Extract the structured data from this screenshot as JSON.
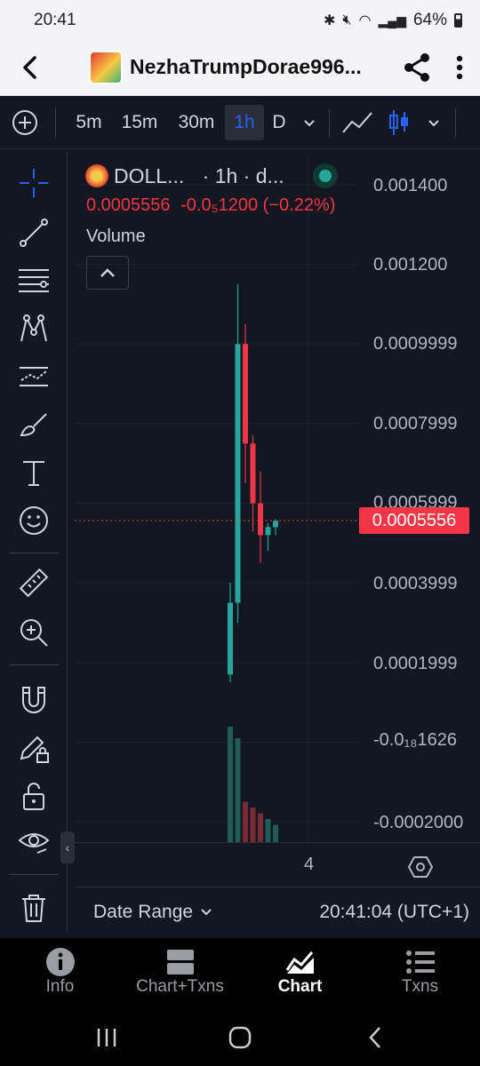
{
  "status_bar": {
    "time": "20:41",
    "battery": "64%"
  },
  "header": {
    "title": "NezhaTrumpDorae996..."
  },
  "toolbar": {
    "intervals": [
      "5m",
      "15m",
      "30m",
      "1h",
      "D"
    ],
    "active_interval": "1h"
  },
  "legend": {
    "symbol": "DOLL...",
    "interval_info": "· 1h · d...",
    "price": "0.0005556",
    "change": "-0.0₅1200 (−0.22%)",
    "volume_label": "Volume"
  },
  "price_axis": {
    "labels": [
      "0.001400",
      "0.001200",
      "0.0009999",
      "0.0007999",
      "0.0005999",
      "0.0003999",
      "0.0001999",
      "-0.0₁₈1626",
      "-0.0002000"
    ],
    "current_price": "0.0005556"
  },
  "time_axis": {
    "tick": "4"
  },
  "bottom_bar": {
    "date_range": "Date Range",
    "clock": "20:41:04 (UTC+1)"
  },
  "nav": {
    "tabs": [
      {
        "label": "Info",
        "icon": "info-icon"
      },
      {
        "label": "Chart+Txns",
        "icon": "split-panel-icon"
      },
      {
        "label": "Chart",
        "icon": "area-chart-icon"
      },
      {
        "label": "Txns",
        "icon": "list-icon"
      }
    ],
    "active": "Chart"
  },
  "colors": {
    "up": "#26a69a",
    "down": "#f23645",
    "background": "#131722",
    "accent": "#2962ff"
  },
  "chart_data": {
    "type": "candlestick",
    "ylim": [
      -0.0002,
      0.0014
    ],
    "candles": [
      {
        "open": 0.00017,
        "high": 0.0004,
        "low": 0.00015,
        "close": 0.00035
      },
      {
        "open": 0.00035,
        "high": 0.00115,
        "low": 0.0003,
        "close": 0.001
      },
      {
        "open": 0.001,
        "high": 0.00105,
        "low": 0.00065,
        "close": 0.00075
      },
      {
        "open": 0.00075,
        "high": 0.00077,
        "low": 0.00053,
        "close": 0.0006
      },
      {
        "open": 0.0006,
        "high": 0.00068,
        "low": 0.00045,
        "close": 0.00052
      },
      {
        "open": 0.00052,
        "high": 0.00055,
        "low": 0.00048,
        "close": 0.00054
      },
      {
        "open": 0.00054,
        "high": 0.00056,
        "low": 0.00052,
        "close": 0.000556
      }
    ],
    "volume": [
      1.0,
      0.9,
      0.35,
      0.3,
      0.25,
      0.2,
      0.15
    ]
  }
}
